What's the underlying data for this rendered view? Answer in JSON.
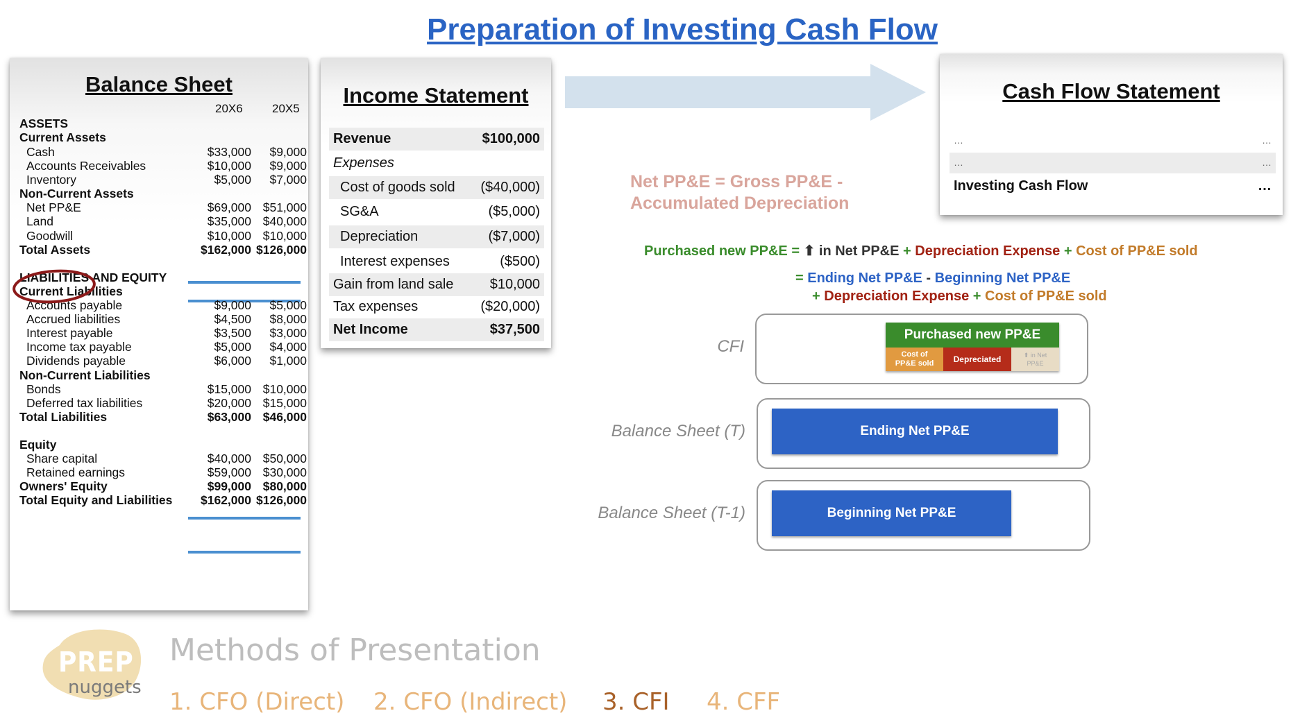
{
  "title": "Preparation of Investing Cash Flow",
  "balance_sheet": {
    "title": "Balance Sheet",
    "col1": "20X6",
    "col2": "20X5",
    "rows": [
      {
        "label": "ASSETS",
        "v1": "",
        "v2": ""
      },
      {
        "label": "Current Assets",
        "v1": "",
        "v2": ""
      },
      {
        "label": "Cash",
        "v1": "$33,000",
        "v2": "$9,000"
      },
      {
        "label": "Accounts Receivables",
        "v1": "$10,000",
        "v2": "$9,000"
      },
      {
        "label": "Inventory",
        "v1": "$5,000",
        "v2": "$7,000"
      },
      {
        "label": "Non-Current Assets",
        "v1": "",
        "v2": ""
      },
      {
        "label": "Net PP&E",
        "v1": "$69,000",
        "v2": "$51,000"
      },
      {
        "label": "Land",
        "v1": "$35,000",
        "v2": "$40,000"
      },
      {
        "label": "Goodwill",
        "v1": "$10,000",
        "v2": "$10,000"
      },
      {
        "label": "Total Assets",
        "v1": "$162,000",
        "v2": "$126,000"
      },
      {
        "label": "LIABILITIES AND EQUITY",
        "v1": "",
        "v2": ""
      },
      {
        "label": "Current Liabilities",
        "v1": "",
        "v2": ""
      },
      {
        "label": "Accounts payable",
        "v1": "$9,000",
        "v2": "$5,000"
      },
      {
        "label": "Accrued liabilities",
        "v1": "$4,500",
        "v2": "$8,000"
      },
      {
        "label": "Interest payable",
        "v1": "$3,500",
        "v2": "$3,000"
      },
      {
        "label": "Income tax payable",
        "v1": "$5,000",
        "v2": "$4,000"
      },
      {
        "label": "Dividends payable",
        "v1": "$6,000",
        "v2": "$1,000"
      },
      {
        "label": "Non-Current Liabilities",
        "v1": "",
        "v2": ""
      },
      {
        "label": "Bonds",
        "v1": "$15,000",
        "v2": "$10,000"
      },
      {
        "label": "Deferred tax liabilities",
        "v1": "$20,000",
        "v2": "$15,000"
      },
      {
        "label": "Total Liabilities",
        "v1": "$63,000",
        "v2": "$46,000"
      },
      {
        "label": "Equity",
        "v1": "",
        "v2": ""
      },
      {
        "label": "Share capital",
        "v1": "$40,000",
        "v2": "$50,000"
      },
      {
        "label": "Retained earnings",
        "v1": "$59,000",
        "v2": "$30,000"
      },
      {
        "label": "Owners' Equity",
        "v1": "$99,000",
        "v2": "$80,000"
      },
      {
        "label": "Total Equity and Liabilities",
        "v1": "$162,000",
        "v2": "$126,000"
      }
    ]
  },
  "income_statement": {
    "title": "Income Statement",
    "rows": [
      {
        "label": "Revenue",
        "value": "$100,000"
      },
      {
        "label": "Expenses",
        "value": ""
      },
      {
        "label": "Cost of goods sold",
        "value": "($40,000)"
      },
      {
        "label": "SG&A",
        "value": "($5,000)"
      },
      {
        "label": "Depreciation",
        "value": "($7,000)"
      },
      {
        "label": "Interest expenses",
        "value": "($500)"
      },
      {
        "label": "Gain from land sale",
        "value": "$10,000"
      },
      {
        "label": "Tax expenses",
        "value": "($20,000)"
      },
      {
        "label": "Net Income",
        "value": "$37,500"
      }
    ]
  },
  "cash_flow_statement": {
    "title": "Cash Flow Statement",
    "rows": [
      {
        "label": "…",
        "value": "…"
      },
      {
        "label": "…",
        "value": "…"
      },
      {
        "label": "Investing Cash Flow",
        "value": "…"
      }
    ]
  },
  "net_ppe_note": {
    "line1": "Net PP&E = Gross PP&E -",
    "line2": "Accumulated Depreciation"
  },
  "formula": {
    "purchased": "Purchased new PP&E",
    "eq": "=",
    "up_arrow": "⬆",
    "in_net": "in Net PP&E",
    "plus": "+",
    "dep_exp": "Depreciation Expense",
    "cost_sold": "Cost of PP&E sold",
    "ending": "Ending Net PP&E",
    "minus": "-",
    "beginning": "Beginning Net PP&E"
  },
  "diagram": {
    "cfi_label": "CFI",
    "bs_t_label": "Balance Sheet (T)",
    "bs_t1_label": "Balance Sheet (T-1)",
    "purchased_bar": "Purchased new PP&E",
    "seg_cost_line1": "Cost of",
    "seg_cost_line2": "PP&E sold",
    "seg_dep": "Depreciated",
    "seg_net_line1": "⬆ in Net",
    "seg_net_line2": "PP&E",
    "ending_bar": "Ending Net PP&E",
    "beginning_bar": "Beginning Net PP&E"
  },
  "footer": {
    "logo_top": "PREP",
    "logo_bottom": "nuggets",
    "heading": "Methods of Presentation",
    "methods": [
      "1. CFO (Direct)",
      "2. CFO (Indirect)",
      "3. CFI",
      "4. CFF"
    ]
  },
  "colors": {
    "title_blue": "#2a64c4",
    "green": "#3a8c2c",
    "blue_bar": "#2d63c5",
    "red": "#a12213",
    "orange": "#c27b2a",
    "arrow": "#d3e1ed",
    "note_pink": "#d9a59c"
  }
}
